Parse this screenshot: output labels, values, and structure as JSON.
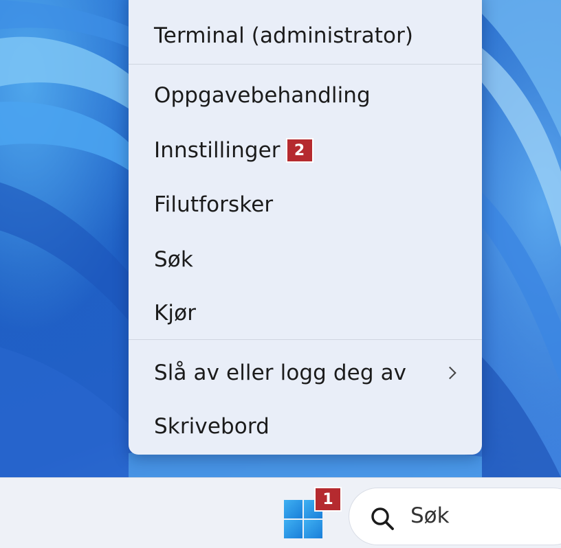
{
  "context_menu": {
    "items": [
      {
        "label": "Terminal (administrator)"
      },
      {
        "label": "Oppgavebehandling"
      },
      {
        "label": "Innstillinger",
        "badge": "2"
      },
      {
        "label": "Filutforsker"
      },
      {
        "label": "Søk"
      },
      {
        "label": "Kjør"
      },
      {
        "label": "Slå av eller logg deg av",
        "has_submenu": true,
        "submenu_icon": "chevron-right-icon"
      },
      {
        "label": "Skrivebord"
      }
    ]
  },
  "taskbar": {
    "start_icon": "windows-logo-icon",
    "start_badge": "1",
    "search": {
      "icon": "search-icon",
      "placeholder": "Søk"
    }
  },
  "colors": {
    "menu_background": "#e9eef8",
    "badge": "#b52a2f",
    "windows_logo": "#2b9be8",
    "taskbar": "#eef1f7",
    "wallpaper": "#1e5fc4"
  }
}
